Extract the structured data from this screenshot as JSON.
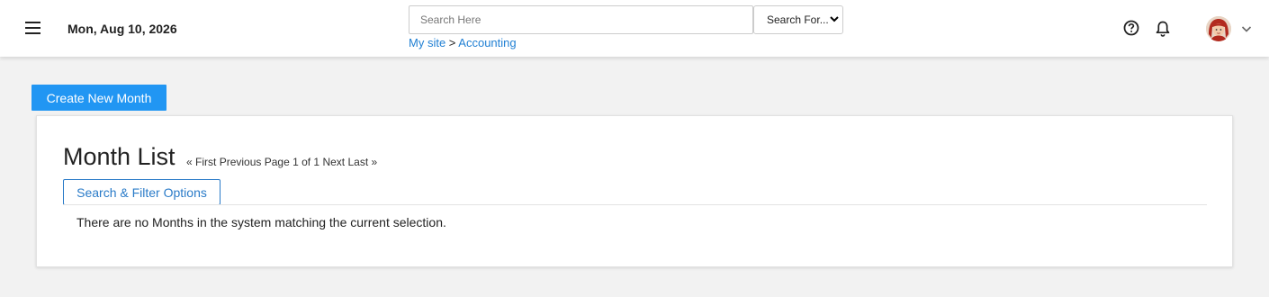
{
  "header": {
    "date": "Mon, Aug 10, 2026",
    "search_placeholder": "Search Here",
    "search_for_label": "Search For...",
    "breadcrumb": {
      "site": "My site",
      "separator": ">",
      "current": "Accounting"
    }
  },
  "toolbar": {
    "create_label": "Create New Month"
  },
  "list": {
    "title": "Month List",
    "pager": {
      "first": "« First",
      "previous": "Previous",
      "page_info": "Page 1 of 1",
      "next": "Next",
      "last": "Last »"
    },
    "filter_label": "Search & Filter Options",
    "empty_message": "There are no Months in the system matching the current selection."
  },
  "colors": {
    "accent": "#2196f3",
    "link": "#1f7fd3",
    "background": "#f2f2f2"
  },
  "icons": [
    "menu-icon",
    "help-icon",
    "bell-icon",
    "chevron-down-icon"
  ]
}
